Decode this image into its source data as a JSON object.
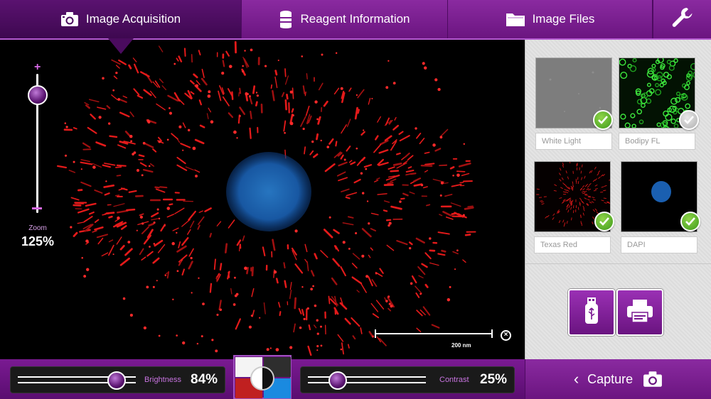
{
  "tabs": {
    "acquisition": {
      "label": "Image Acquisition",
      "icon": "camera-icon"
    },
    "reagent": {
      "label": "Reagent Information",
      "icon": "reagent-bottle-icon"
    },
    "files": {
      "label": "Image Files",
      "icon": "folder-icon"
    },
    "settings": {
      "icon": "wrench-icon"
    }
  },
  "zoom": {
    "label": "Zoom",
    "value": "125%",
    "plus": "+",
    "level_fraction": 0.92
  },
  "scale_bar": {
    "label": "200 nm",
    "close": "×"
  },
  "channels": [
    {
      "label": "White Light",
      "checked": true
    },
    {
      "label": "Bodipy FL",
      "checked": false
    },
    {
      "label": "Texas Red",
      "checked": true
    },
    {
      "label": "DAPI",
      "checked": true
    }
  ],
  "actions": {
    "usb": "usb-icon",
    "print": "printer-icon"
  },
  "brightness": {
    "label": "Brightness",
    "value": "84%",
    "fraction": 0.84
  },
  "contrast": {
    "label": "Contrast",
    "value": "25%",
    "fraction": 0.25
  },
  "capture": {
    "label": "Capture",
    "chevron": "‹"
  },
  "colors": {
    "accent": "#7a1a92",
    "check_on": "#4fae1e",
    "texas_red": "#e01818",
    "dapi": "#1a5fb0"
  }
}
